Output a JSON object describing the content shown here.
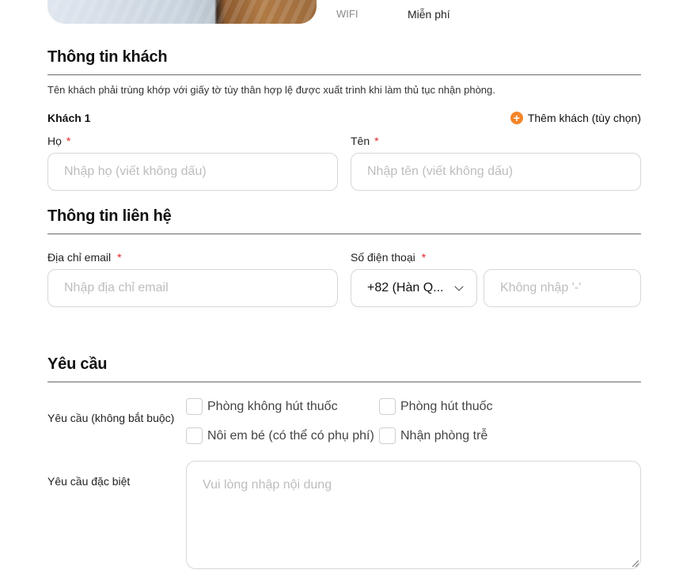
{
  "amenity": {
    "name": "WIFI",
    "value": "Miễn phí"
  },
  "guest_info": {
    "title": "Thông tin khách",
    "note": "Tên khách phải trùng khớp với giấy tờ tùy thân hợp lệ được xuất trình khi làm thủ tục nhận phòng.",
    "guest_label": "Khách 1",
    "add_guest_label": "Thêm khách (tùy chọn)",
    "last_name": {
      "label": "Họ",
      "required_mark": "*",
      "placeholder": "Nhập họ (viết không dấu)"
    },
    "first_name": {
      "label": "Tên",
      "required_mark": "*",
      "placeholder": "Nhập tên (viết không dấu)"
    }
  },
  "contact_info": {
    "title": "Thông tin liên hệ",
    "email": {
      "label": "Địa chỉ email",
      "required_mark": "*",
      "placeholder": "Nhập địa chỉ email"
    },
    "phone": {
      "label": "Số điện thoại",
      "required_mark": "*",
      "country_code": "+82 (Hàn Q...",
      "placeholder": "Không nhập '-'"
    }
  },
  "requests": {
    "title": "Yêu cầu",
    "optional_label": "Yêu cầu (không bắt buộc)",
    "options": [
      "Phòng không hút thuốc",
      "Phòng hút thuốc",
      "Nôi em bé (có thể có phụ phí)",
      "Nhận phòng trễ"
    ],
    "special_label": "Yêu cầu đặc biệt",
    "special_placeholder": "Vui lòng nhập nội dung"
  }
}
